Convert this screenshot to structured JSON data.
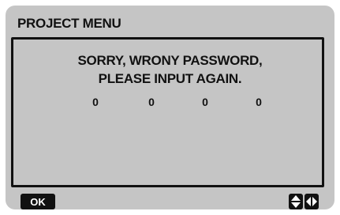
{
  "screen": {
    "title": "PROJECT MENU",
    "message_line1": "SORRY, WRONY PASSWORD,",
    "message_line2": "PLEASE INPUT AGAIN.",
    "password_digits": [
      "0",
      "0",
      "0",
      "0"
    ]
  },
  "footer": {
    "ok_label": "OK",
    "icons": [
      "up-down-arrow-icon",
      "left-right-arrow-icon"
    ]
  },
  "colors": {
    "background": "#c5c5c5",
    "foreground": "#111111"
  }
}
